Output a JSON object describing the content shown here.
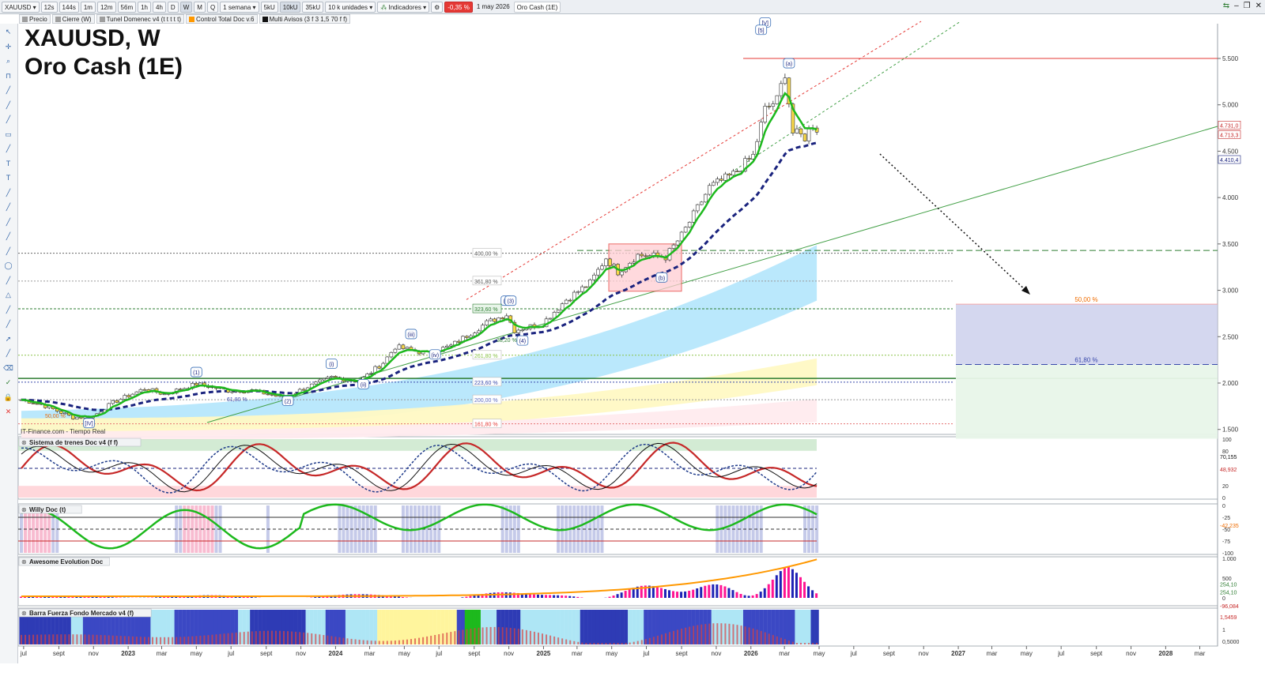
{
  "toolbar": {
    "symbol": "XAUUSD",
    "timeframes": [
      "12s",
      "144s",
      "1m",
      "12m",
      "56m",
      "1h",
      "4h",
      "D",
      "W",
      "M",
      "Q"
    ],
    "active_timeframe": "W",
    "period": "1 semana",
    "sizes": [
      "5kU",
      "10kU",
      "35kU"
    ],
    "active_size": "10kU",
    "units": "10 k unidades",
    "indicators_label": "Indicadores",
    "change_badge": "-0,35 %",
    "date_label": "1 may 2026",
    "name_label": "Oro Cash (1E)"
  },
  "legend": [
    "Precio",
    "Cierre (W)",
    "Tunel Domenec v4 (t t t t t)",
    "Control Total Doc v.6",
    "Multi Avisos (3 f 3 1,5 70 f f)"
  ],
  "title_line1": "XAUUSD, W",
  "title_line2": "Oro Cash (1E)",
  "source_label": "IT-Finance.com - Tiempo Real",
  "panels": {
    "p1": "Sistema de trenes Doc v4 (f f)",
    "p2": "Willy Doc (t)",
    "p3": "Awesome Evolution Doc",
    "p4": "Barra Fuerza Fondo Mercado v4 (f)"
  },
  "colors": {
    "up": "#2e7d32",
    "down": "#c62828",
    "ema_green": "#1db91d",
    "blue_dash": "#1a237e",
    "cyan_band": "#81d4fa",
    "yellow_band": "#fff59d",
    "pink_band": "#ffcdd2",
    "resistance": "#e53935"
  },
  "chart_data": [
    {
      "type": "line",
      "title": "XAUUSD, W",
      "subtitle": "Oro Cash (1E)",
      "xlabel": "",
      "ylabel": "",
      "y_ticks": [
        "1.500",
        "2.000",
        "2.500",
        "3.000",
        "3.500",
        "4.000",
        "4.500",
        "5.000",
        "5.500"
      ],
      "ylim": [
        1400,
        5800
      ],
      "x_ticks": [
        "jul",
        "sept",
        "nov",
        "2023",
        "mar",
        "may",
        "jul",
        "sept",
        "nov",
        "2024",
        "mar",
        "may",
        "jul",
        "sept",
        "nov",
        "2025",
        "mar",
        "may",
        "jul",
        "sept",
        "nov",
        "2026",
        "mar",
        "may",
        "jul",
        "sept",
        "nov",
        "2027",
        "mar",
        "may",
        "jul",
        "sept",
        "nov",
        "2028",
        "mar"
      ],
      "price_labels": [
        "4.731,0",
        "4.713,3",
        "4.410,4"
      ],
      "fib_labels": [
        "400,00 %",
        "361,80 %",
        "323,60 %",
        "261,80 %",
        "223,60 %",
        "200,00 %",
        "161,80 %",
        "61,80 %",
        "50,00 %",
        "38,20 %"
      ],
      "target_zone_labels": [
        "50,00 %",
        "61,80 %"
      ],
      "wave_labels": [
        "[IV]",
        "(1)",
        "(2)",
        "(i)",
        "(ii)",
        "(iii)",
        "(iv)",
        "(v)",
        "(3)",
        "(4)",
        "[V]",
        "[5]",
        "(a)",
        "(b)"
      ],
      "series": [
        {
          "name": "Precio",
          "values": [
            [
              "2022-06-27",
              1820
            ],
            [
              "2022-08-01",
              1770
            ],
            [
              "2022-09-26",
              1630
            ],
            [
              "2022-10-31",
              1640
            ],
            [
              "2022-12-05",
              1790
            ],
            [
              "2023-01-30",
              1940
            ],
            [
              "2023-03-06",
              1880
            ],
            [
              "2023-05-01",
              1990
            ],
            [
              "2023-06-26",
              1920
            ],
            [
              "2023-08-07",
              1920
            ],
            [
              "2023-10-02",
              1840
            ],
            [
              "2023-11-13",
              1960
            ],
            [
              "2023-12-25",
              2060
            ],
            [
              "2024-02-12",
              2020
            ],
            [
              "2024-03-25",
              2220
            ],
            [
              "2024-04-15",
              2390
            ],
            [
              "2024-06-10",
              2320
            ],
            [
              "2024-07-22",
              2400
            ],
            [
              "2024-09-23",
              2650
            ],
            [
              "2024-10-28",
              2740
            ],
            [
              "2024-11-11",
              2570
            ],
            [
              "2024-12-30",
              2640
            ],
            [
              "2025-02-10",
              2900
            ],
            [
              "2025-03-24",
              3080
            ],
            [
              "2025-04-21",
              3350
            ],
            [
              "2025-05-12",
              3200
            ],
            [
              "2025-06-16",
              3380
            ],
            [
              "2025-08-04",
              3360
            ],
            [
              "2025-09-01",
              3590
            ],
            [
              "2025-10-06",
              3960
            ],
            [
              "2025-10-20",
              4110
            ],
            [
              "2025-12-01",
              4250
            ],
            [
              "2026-01-05",
              4450
            ],
            [
              "2026-01-26",
              4950
            ],
            [
              "2026-02-16",
              5050
            ],
            [
              "2026-03-02",
              5350
            ],
            [
              "2026-03-16",
              4700
            ],
            [
              "2026-04-06",
              4650
            ],
            [
              "2026-04-20",
              4790
            ],
            [
              "2026-05-01",
              4713
            ]
          ]
        }
      ]
    },
    {
      "type": "line",
      "title": "Sistema de trenes Doc v4 (f f)",
      "y_ticks": [
        "100",
        "80",
        "20",
        "0"
      ],
      "ylim": [
        0,
        100
      ],
      "value_labels": [
        "70,155",
        "48,932"
      ]
    },
    {
      "type": "line",
      "title": "Willy Doc (t)",
      "y_ticks": [
        "0",
        "-25",
        "-50",
        "-75",
        "-100"
      ],
      "ylim": [
        -100,
        0
      ],
      "value_labels": [
        "-42,235"
      ]
    },
    {
      "type": "bar",
      "title": "Awesome Evolution Doc",
      "y_ticks": [
        "1.000",
        "500",
        "0"
      ],
      "value_labels": [
        "254,10",
        "254,10",
        "-96,084"
      ]
    },
    {
      "type": "bar",
      "title": "Barra Fuerza Fondo Mercado v4 (f)",
      "y_ticks": [
        "1",
        "0,5000"
      ],
      "value_labels": [
        "1,5459"
      ]
    }
  ]
}
